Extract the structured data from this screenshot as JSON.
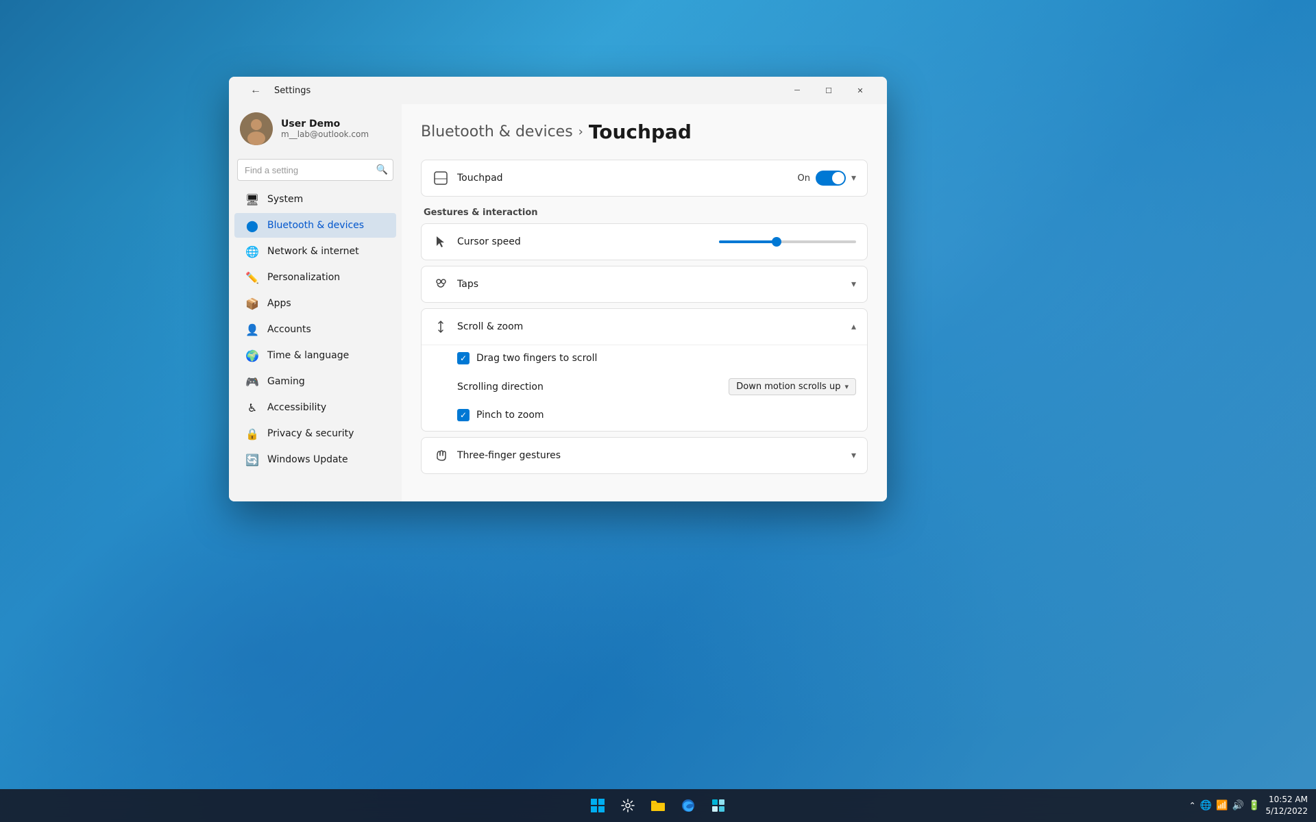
{
  "window": {
    "title": "Settings",
    "back_label": "←"
  },
  "user": {
    "name": "User Demo",
    "email": "m__lab@outlook.com"
  },
  "search": {
    "placeholder": "Find a setting"
  },
  "sidebar": {
    "items": [
      {
        "id": "system",
        "label": "System",
        "icon": "🖥"
      },
      {
        "id": "bluetooth",
        "label": "Bluetooth & devices",
        "icon": "🔵"
      },
      {
        "id": "network",
        "label": "Network & internet",
        "icon": "🌐"
      },
      {
        "id": "personalization",
        "label": "Personalization",
        "icon": "✏️"
      },
      {
        "id": "apps",
        "label": "Apps",
        "icon": "📦"
      },
      {
        "id": "accounts",
        "label": "Accounts",
        "icon": "👤"
      },
      {
        "id": "time",
        "label": "Time & language",
        "icon": "🌍"
      },
      {
        "id": "gaming",
        "label": "Gaming",
        "icon": "🎮"
      },
      {
        "id": "accessibility",
        "label": "Accessibility",
        "icon": "♿"
      },
      {
        "id": "privacy",
        "label": "Privacy & security",
        "icon": "🔒"
      },
      {
        "id": "update",
        "label": "Windows Update",
        "icon": "🔄"
      }
    ]
  },
  "breadcrumb": {
    "parent": "Bluetooth & devices",
    "separator": "›",
    "current": "Touchpad"
  },
  "touchpad_toggle": {
    "label": "Touchpad",
    "state": "On"
  },
  "gestures_section": {
    "title": "Gestures & interaction"
  },
  "cursor_speed": {
    "label": "Cursor speed",
    "value": 42
  },
  "taps": {
    "label": "Taps"
  },
  "scroll_zoom": {
    "label": "Scroll & zoom",
    "drag_two_fingers_label": "Drag two fingers to scroll",
    "scrolling_direction_label": "Scrolling direction",
    "scrolling_direction_value": "Down motion scrolls up",
    "pinch_to_zoom_label": "Pinch to zoom"
  },
  "three_finger": {
    "label": "Three-finger gestures"
  },
  "taskbar": {
    "time": "10:52 AM",
    "date": "5/12/2022",
    "icons": [
      "🪟",
      "⚙",
      "📁",
      "🌐",
      "🪟"
    ]
  },
  "colors": {
    "accent": "#0078d4",
    "active_nav": "rgba(0,100,200,0.12)"
  }
}
